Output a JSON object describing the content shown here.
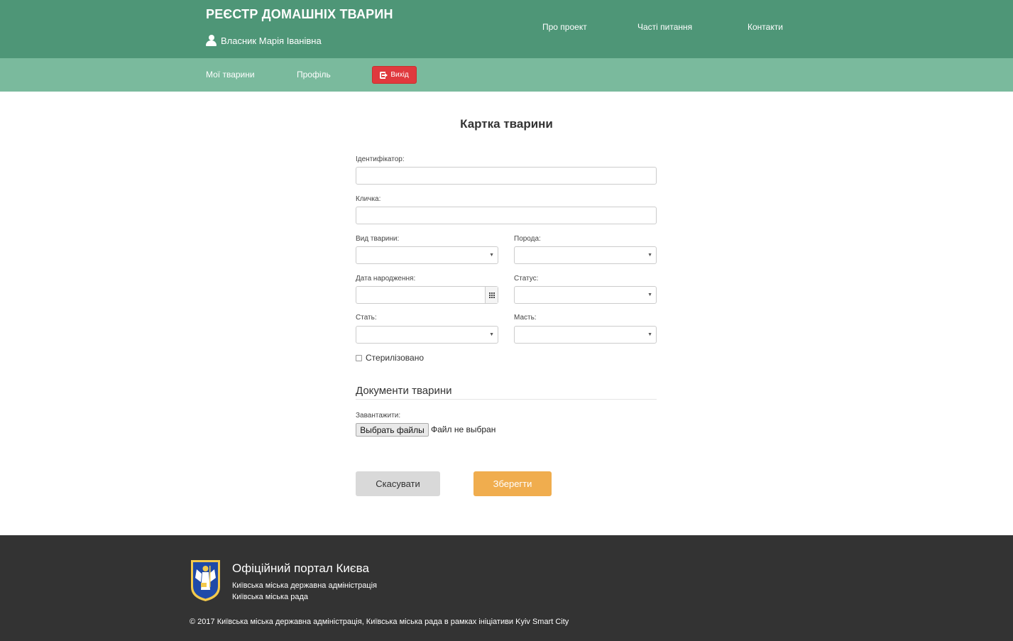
{
  "header": {
    "site_title": "РЕЄСТР ДОМАШНІХ ТВАРИН",
    "owner_name": "Власник Марія Іванівна",
    "nav": [
      "Про проект",
      "Часті питання",
      "Контакти"
    ]
  },
  "subnav": {
    "items": [
      "Мої тварини",
      "Профіль"
    ],
    "logout_label": "Вихід"
  },
  "form": {
    "title": "Картка тварини",
    "fields": {
      "identifier": {
        "label": "Ідентифікатор:",
        "value": ""
      },
      "nickname": {
        "label": "Кличка:",
        "value": ""
      },
      "species": {
        "label": "Вид тварини:",
        "value": ""
      },
      "breed": {
        "label": "Порода:",
        "value": ""
      },
      "birth_date": {
        "label": "Дата народження:",
        "value": ""
      },
      "status": {
        "label": "Статус:",
        "value": ""
      },
      "sex": {
        "label": "Стать:",
        "value": ""
      },
      "color": {
        "label": "Масть:",
        "value": ""
      }
    },
    "sterilized": {
      "label": "Стерилізовано",
      "checked": false
    },
    "documents": {
      "title": "Документи тварини",
      "upload_label": "Завантажити:",
      "choose_files": "Выбрать файлы",
      "no_file": "Файл не выбран"
    },
    "cancel_label": "Скасувати",
    "save_label": "Зберегти"
  },
  "footer": {
    "portal_title": "Офіційний портал Києва",
    "line1": "Київська міська державна адміністрація",
    "line2": "Київська міська рада",
    "copyright": "© 2017 Київська міська державна адміністрація, Київська міська рада в рамках ініціативи Kyiv Smart City"
  },
  "colors": {
    "header_bg": "#4e9677",
    "subnav_bg": "#7aba9d",
    "logout_bg": "#e0393e",
    "save_bg": "#f0ad4e",
    "footer_bg": "#333333"
  }
}
